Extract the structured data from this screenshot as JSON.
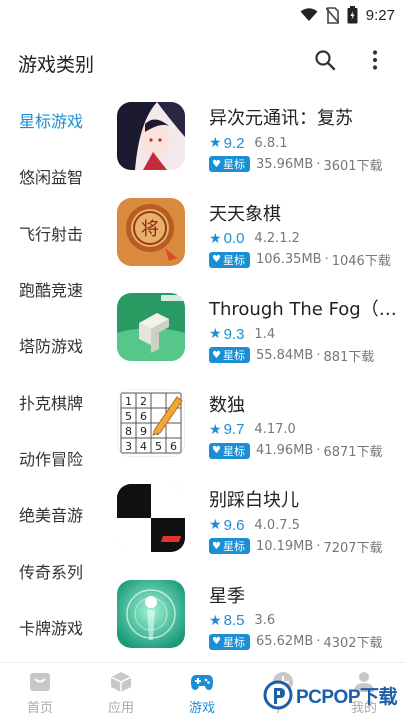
{
  "status_bar": {
    "time": "9:27"
  },
  "header": {
    "title": "游戏类别"
  },
  "sidebar": {
    "items": [
      {
        "label": "星标游戏",
        "active": true
      },
      {
        "label": "悠闲益智"
      },
      {
        "label": "飞行射击"
      },
      {
        "label": "跑酷竞速"
      },
      {
        "label": "塔防游戏"
      },
      {
        "label": "扑克棋牌"
      },
      {
        "label": "动作冒险"
      },
      {
        "label": "绝美音游"
      },
      {
        "label": "传奇系列"
      },
      {
        "label": "卡牌游戏"
      }
    ]
  },
  "games": [
    {
      "title": "异次元通讯：复苏",
      "rating": "9.2",
      "version": "6.8.1",
      "badge": "星标",
      "size": "35.96MB",
      "downloads": "3601下载"
    },
    {
      "title": "天天象棋",
      "rating": "0.0",
      "version": "4.2.1.2",
      "badge": "星标",
      "size": "106.35MB",
      "downloads": "1046下载"
    },
    {
      "title": "Through The Fog（穿越迷雾）",
      "rating": "9.3",
      "version": "1.4",
      "badge": "星标",
      "size": "55.84MB",
      "downloads": "881下载"
    },
    {
      "title": "数独",
      "rating": "9.7",
      "version": "4.17.0",
      "badge": "星标",
      "size": "41.96MB",
      "downloads": "6871下载"
    },
    {
      "title": "别踩白块儿",
      "rating": "9.6",
      "version": "4.0.7.5",
      "badge": "星标",
      "size": "10.19MB",
      "downloads": "7207下载"
    },
    {
      "title": "星季",
      "rating": "8.5",
      "version": "3.6",
      "badge": "星标",
      "size": "65.62MB",
      "downloads": "4302下载"
    }
  ],
  "sep": "·",
  "bottom_nav": {
    "items": [
      {
        "label": "首页",
        "icon": "home-icon"
      },
      {
        "label": "应用",
        "icon": "cube-icon"
      },
      {
        "label": "游戏",
        "icon": "gamepad-icon",
        "active": true
      },
      {
        "label": "广",
        "icon": "ad-icon"
      },
      {
        "label": "我的",
        "icon": "user-icon"
      }
    ]
  },
  "watermark": {
    "text": "PCPOP下载"
  },
  "colors": {
    "accent": "#1a8fd6",
    "active_bg": "#e9f4fb"
  }
}
